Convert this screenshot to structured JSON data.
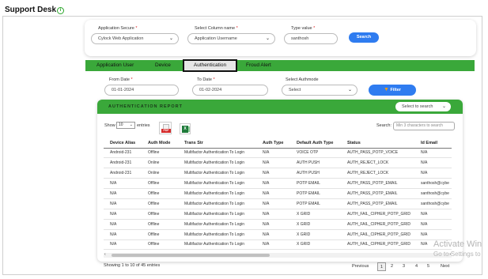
{
  "page": {
    "title": "Support Desk"
  },
  "filters": {
    "app_secure_label": "Application Secure",
    "app_secure_value": "Cylock Web Application",
    "column_label": "Select Column name",
    "column_value": "Application Username",
    "type_label": "Type value",
    "type_value": "santhosh",
    "search_button": "Search",
    "required_mark": "*"
  },
  "tabs": [
    "Application User",
    "Device",
    "Authentication",
    "Froud Alert"
  ],
  "active_tab": "Authentication",
  "date_filters": {
    "from_label": "From Date",
    "from_value": "01-01-2024",
    "to_label": "To Date",
    "to_value": "01-02-2024",
    "mode_label": "Select Authmode",
    "mode_value": "Select",
    "filter_button": "Filter"
  },
  "report": {
    "title": "AUTHENTICATION REPORT",
    "select_to_search": "Select to search",
    "show_label": "Show",
    "show_value": "10",
    "entries_label": "entries",
    "search_label": "Search:",
    "search_placeholder": "Min 3 characters to search",
    "pdf_label": "PDF",
    "xls_label": "X",
    "columns": [
      "Device Alias",
      "Auth Mode",
      "Trans Str",
      "Auth Type",
      "Default Auth Type",
      "Status",
      "Id Email"
    ],
    "rows": [
      [
        "Android-231",
        "Offline",
        "Multifactor Authentication To Login",
        "N/A",
        "VOICE OTP",
        "AUTH_PASS_POTP_VOICE",
        "N/A"
      ],
      [
        "Android-231",
        "Online",
        "Multifactor Authentication To Login",
        "N/A",
        "AUTH PUSH",
        "AUTH_REJECT_LOCK",
        "N/A"
      ],
      [
        "Android-231",
        "Online",
        "Multifactor Authentication To Login",
        "N/A",
        "AUTH PUSH",
        "AUTH_REJECT_LOCK",
        "N/A"
      ],
      [
        "N/A",
        "Offline",
        "Multifactor Authentication To Login",
        "N/A",
        "POTP EMAIL",
        "AUTH_PASS_POTP_EMAIL",
        "santhosh@cybe"
      ],
      [
        "N/A",
        "Offline",
        "Multifactor Authentication To Login",
        "N/A",
        "POTP EMAIL",
        "AUTH_PASS_POTP_EMAIL",
        "santhosh@cybe"
      ],
      [
        "N/A",
        "Offline",
        "Multifactor Authentication To Login",
        "N/A",
        "POTP EMAIL",
        "AUTH_PASS_POTP_EMAIL",
        "santhosh@cybe"
      ],
      [
        "N/A",
        "Offline",
        "Multifactor Authentication To Login",
        "N/A",
        "X GRID",
        "AUTH_FAIL_CIPHER_POTP_GRID",
        "N/A"
      ],
      [
        "N/A",
        "Offline",
        "Multifactor Authentication To Login",
        "N/A",
        "X GRID",
        "AUTH_FAIL_CIPHER_POTP_GRID",
        "N/A"
      ],
      [
        "N/A",
        "Offline",
        "Multifactor Authentication To Login",
        "N/A",
        "X GRID",
        "AUTH_FAIL_CIPHER_POTP_GRID",
        "N/A"
      ],
      [
        "N/A",
        "Offline",
        "Multifactor Authentication To Login",
        "N/A",
        "X GRID",
        "AUTH_FAIL_CIPHER_POTP_GRID",
        "N/A"
      ]
    ],
    "showing": "Showing 1 to 10 of 45 entries",
    "pager": {
      "previous": "Previous",
      "pages": [
        "1",
        "2",
        "3",
        "4",
        "5"
      ],
      "current": "1",
      "next": "Next"
    }
  },
  "watermark": {
    "line1": "Activate Win",
    "line2": "Go to Settings to"
  },
  "colors": {
    "green": "#3aa83a",
    "blue": "#2f7cf0",
    "orange": "#f39c12"
  }
}
